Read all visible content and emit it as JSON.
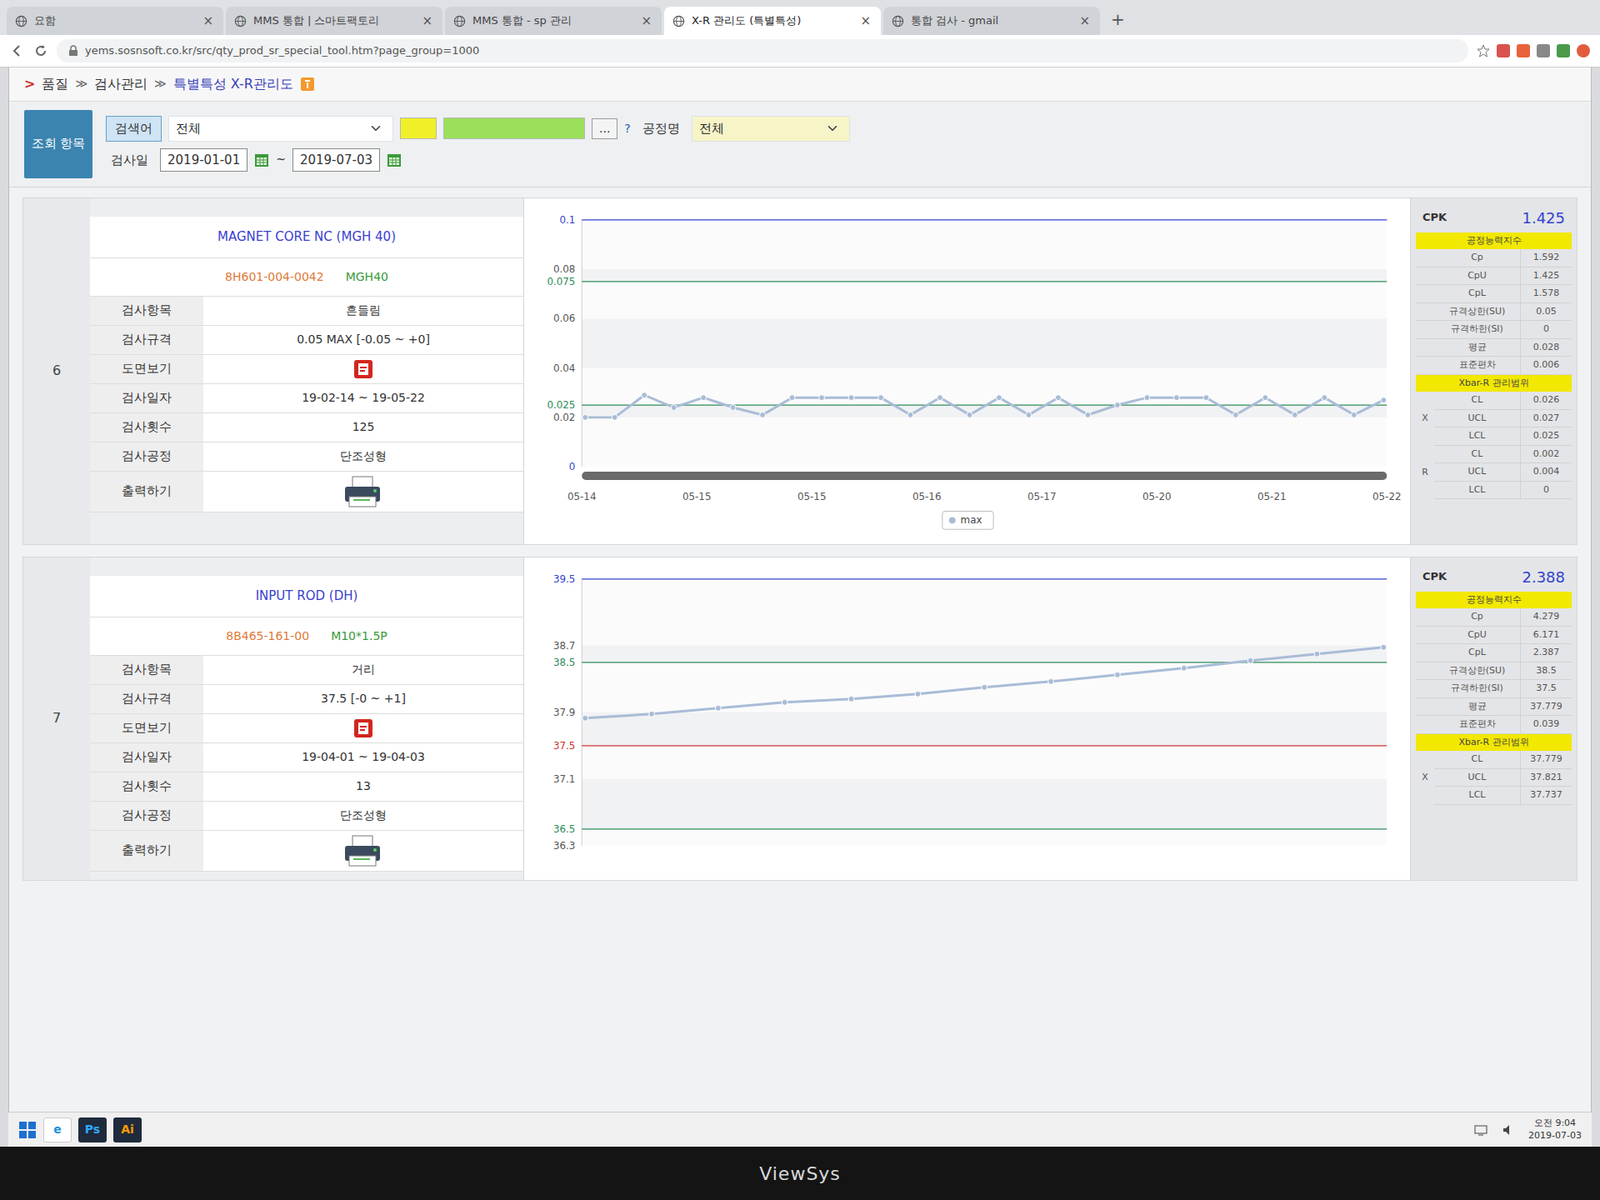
{
  "browser": {
    "tabs": [
      {
        "label": "요함",
        "selected": false
      },
      {
        "label": "MMS 통합 | 스마트팩토리",
        "selected": false
      },
      {
        "label": "MMS 통합 - sp 관리",
        "selected": false
      },
      {
        "label": "X-R 관리도 (특별특성)",
        "selected": true
      },
      {
        "label": "통합 검사 - gmail",
        "selected": false
      }
    ],
    "tab_close": "×",
    "new_tab": "+",
    "address": "yems.sosnsoft.co.kr/src/qty_prod_sr_special_tool.htm?page_group=1000"
  },
  "breadcrumb": {
    "marker": ">",
    "separator": "≫",
    "items": [
      "품질",
      "검사관리",
      "특별특성 X-R관리도"
    ]
  },
  "search": {
    "side_label": "조회 항목",
    "keyword_label": "검색어",
    "keyword_select": "전체",
    "more_button": "...",
    "help": "?",
    "process_label": "공정명",
    "process_select": "전체",
    "date_label": "검사일",
    "date_from": "2019-01-01",
    "date_sep": "~",
    "date_to": "2019-07-03"
  },
  "items": [
    {
      "no": "6",
      "title": "MAGNET CORE NC (MGH 40)",
      "part_no": "8H601-004-0042",
      "model": "MGH40",
      "fields": [
        {
          "label": "검사항목",
          "kind": "text",
          "value": "흔들림"
        },
        {
          "label": "검사규격",
          "kind": "text",
          "value": "0.05 MAX [-0.05 ~ +0]"
        },
        {
          "label": "도면보기",
          "kind": "drawing"
        },
        {
          "label": "검사일자",
          "kind": "text",
          "value": "19-02-14 ~ 19-05-22"
        },
        {
          "label": "검사횟수",
          "kind": "text",
          "value": "125"
        },
        {
          "label": "검사공정",
          "kind": "text",
          "value": "단조성형"
        },
        {
          "label": "출력하기",
          "kind": "print"
        }
      ],
      "chart": {
        "axis": {
          "min": 0,
          "max": 0.1
        },
        "ticks": [
          {
            "label": "0.1",
            "color": "#3344cc"
          },
          {
            "label": "0.08",
            "color": "#555555"
          },
          {
            "label": "0.075",
            "color": "#2e8b57"
          },
          {
            "label": "0.06",
            "color": "#555555"
          },
          {
            "label": "0.04",
            "color": "#555555"
          },
          {
            "label": "0.025",
            "color": "#2e8b57"
          },
          {
            "label": "0.02",
            "color": "#555555"
          },
          {
            "label": "0",
            "color": "#3344cc"
          }
        ],
        "limits": [
          {
            "value": 0.1,
            "color": "#3344cc"
          },
          {
            "value": 0.075,
            "color": "#2e8b57"
          },
          {
            "value": 0.025,
            "color": "#2e8b57"
          }
        ],
        "series": [
          {
            "name": "max",
            "color": "#a9bcd6",
            "values": [
              0.02,
              0.02,
              0.029,
              0.024,
              0.028,
              0.024,
              0.021,
              0.028,
              0.028,
              0.028,
              0.028,
              0.021,
              0.028,
              0.021,
              0.028,
              0.021,
              0.028,
              0.021,
              0.025,
              0.028,
              0.028,
              0.028,
              0.021,
              0.028,
              0.021,
              0.028,
              0.021,
              0.027
            ]
          }
        ],
        "scrollbar": {
          "level": 1
        },
        "x_labels": [
          "05-14",
          "05-15",
          "05-15",
          "05-16",
          "05-17",
          "05-20",
          "05-21",
          "05-22"
        ]
      },
      "stats": {
        "cpk_label": "CPK",
        "cpk": "1.425",
        "sections": [
          {
            "header": "공정능력지수",
            "rows": [
              {
                "label": "Cp",
                "value": "1.592"
              },
              {
                "label": "CpU",
                "value": "1.425"
              },
              {
                "label": "CpL",
                "value": "1.578"
              },
              {
                "label": "규격상한(SU)",
                "value": "0.05"
              },
              {
                "label": "규격하한(SI)",
                "value": "0"
              },
              {
                "label": "평균",
                "value": "0.028"
              },
              {
                "label": "표준편차",
                "value": "0.006"
              }
            ]
          },
          {
            "header": "Xbar-R 관리범위",
            "groups": [
              {
                "name": "X",
                "rows": [
                  {
                    "label": "CL",
                    "value": "0.026"
                  },
                  {
                    "label": "UCL",
                    "value": "0.027"
                  },
                  {
                    "label": "LCL",
                    "value": "0.025"
                  }
                ]
              },
              {
                "name": "R",
                "rows": [
                  {
                    "label": "CL",
                    "value": "0.002"
                  },
                  {
                    "label": "UCL",
                    "value": "0.004"
                  },
                  {
                    "label": "LCL",
                    "value": "0"
                  }
                ]
              }
            ]
          }
        ]
      }
    },
    {
      "no": "7",
      "title": "INPUT ROD (DH)",
      "part_no": "8B465-161-00",
      "model": "M10*1.5P",
      "fields": [
        {
          "label": "검사항목",
          "kind": "text",
          "value": "거리"
        },
        {
          "label": "검사규격",
          "kind": "text",
          "value": "37.5 [-0 ~ +1]"
        },
        {
          "label": "도면보기",
          "kind": "drawing"
        },
        {
          "label": "검사일자",
          "kind": "text",
          "value": "19-04-01 ~ 19-04-03"
        },
        {
          "label": "검사횟수",
          "kind": "text",
          "value": "13"
        },
        {
          "label": "검사공정",
          "kind": "text",
          "value": "단조성형"
        },
        {
          "label": "출력하기",
          "kind": "print"
        }
      ],
      "chart": {
        "axis": {
          "min": 36.3,
          "max": 39.5
        },
        "ticks": [
          {
            "label": "39.5",
            "color": "#3344cc"
          },
          {
            "label": "38.7",
            "color": "#555555"
          },
          {
            "label": "38.5",
            "color": "#2e8b57"
          },
          {
            "label": "37.9",
            "color": "#555555"
          },
          {
            "label": "37.5",
            "color": "#cc3333"
          },
          {
            "label": "37.1",
            "color": "#555555"
          },
          {
            "label": "36.5",
            "color": "#2e8b57"
          },
          {
            "label": "36.3",
            "color": "#555555"
          }
        ],
        "limits": [
          {
            "value": 39.5,
            "color": "#3344cc"
          },
          {
            "value": 38.5,
            "color": "#2e8b57"
          },
          {
            "value": 37.5,
            "color": "#cc3333"
          },
          {
            "value": 36.5,
            "color": "#2e8b57"
          }
        ],
        "series": [
          {
            "color": "#a9bcd6",
            "values": [
              37.83,
              37.88,
              37.95,
              38.02,
              38.06,
              38.12,
              38.2,
              38.27,
              38.35,
              38.43,
              38.52,
              38.6,
              38.68
            ]
          }
        ]
      },
      "stats": {
        "cpk_label": "CPK",
        "cpk": "2.388",
        "sections": [
          {
            "header": "공정능력지수",
            "rows": [
              {
                "label": "Cp",
                "value": "4.279"
              },
              {
                "label": "CpU",
                "value": "6.171"
              },
              {
                "label": "CpL",
                "value": "2.387"
              },
              {
                "label": "규격상한(SU)",
                "value": "38.5"
              },
              {
                "label": "규격하한(SI)",
                "value": "37.5"
              },
              {
                "label": "평균",
                "value": "37.779"
              },
              {
                "label": "표준편차",
                "value": "0.039"
              }
            ]
          },
          {
            "header": "Xbar-R 관리범위",
            "groups": [
              {
                "name": "X",
                "rows": [
                  {
                    "label": "CL",
                    "value": "37.779"
                  },
                  {
                    "label": "UCL",
                    "value": "37.821"
                  },
                  {
                    "label": "LCL",
                    "value": "37.737"
                  }
                ]
              }
            ]
          }
        ]
      }
    }
  ],
  "taskbar": {
    "apps": [
      {
        "label": "e",
        "color": "#1e90d6"
      },
      {
        "label": "Ps",
        "color": "#31a8ff"
      },
      {
        "label": "Ai",
        "color": "#ff9a00"
      }
    ],
    "time": "오전 9:04",
    "date": "2019-07-03"
  },
  "monitor": {
    "brand": "ViewSys"
  }
}
